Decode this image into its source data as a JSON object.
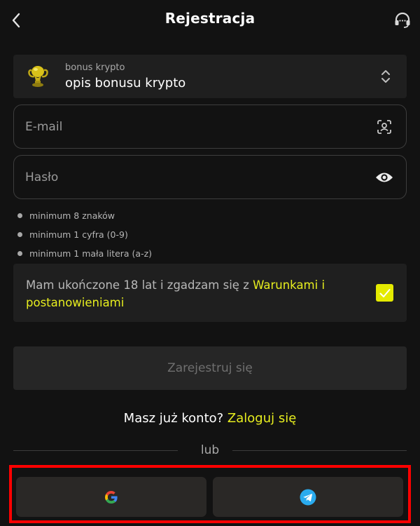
{
  "header": {
    "title": "Rejestracja",
    "back_icon": "chevron-left-icon",
    "support_icon": "headset-icon"
  },
  "bonus": {
    "label": "bonus krypto",
    "value": "opis bonusu krypto",
    "icon": "trophy-icon",
    "selector_icon": "chevron-up-down-icon"
  },
  "email": {
    "placeholder": "E-mail",
    "value": "",
    "icon": "user-scan-icon"
  },
  "password": {
    "placeholder": "Hasło",
    "value": "",
    "icon": "eye-icon"
  },
  "password_rules": [
    "minimum 8 znaków",
    "minimum 1 cyfra (0-9)",
    "minimum 1 mała litera (a-z)"
  ],
  "terms": {
    "text": "Mam ukończone 18 lat i zgadzam się z ",
    "link": "Warunkami i postanowieniami",
    "checked": true
  },
  "register_button": "Zarejestruj się",
  "login_prompt": {
    "text": "Masz już konto?",
    "link": "Zaloguj się"
  },
  "divider_text": "lub",
  "social": [
    {
      "name": "Google",
      "icon": "google-icon"
    },
    {
      "name": "Telegram",
      "icon": "telegram-icon"
    }
  ],
  "colors": {
    "background": "#121212",
    "card": "#1f1f1f",
    "accent": "#e7ee1f",
    "highlight_frame": "#ff0000"
  }
}
